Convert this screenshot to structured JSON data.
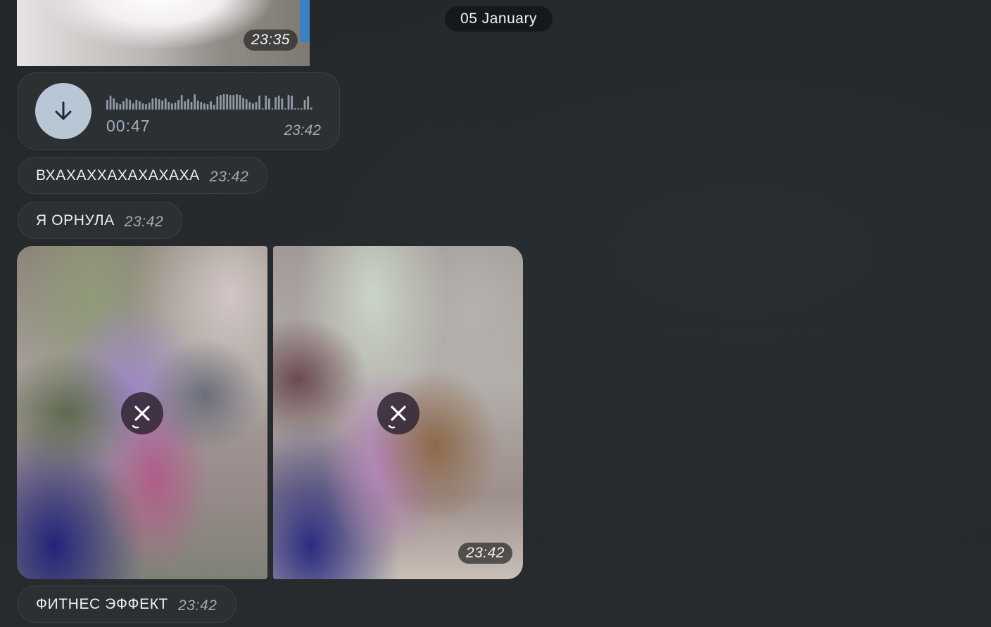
{
  "date_separator": "05 January",
  "messages": [
    {
      "kind": "photo",
      "time": "23:35"
    },
    {
      "kind": "voice",
      "duration": "00:47",
      "time": "23:42"
    },
    {
      "kind": "text",
      "text": "ВХАХАХХАХАХАХАХА",
      "time": "23:42"
    },
    {
      "kind": "text",
      "text": "Я ОРНУЛА",
      "time": "23:42"
    },
    {
      "kind": "album",
      "items": 2,
      "time": "23:42"
    },
    {
      "kind": "text",
      "text": "ФИТНЕС ЭФФЕКТ",
      "time": "23:42"
    }
  ],
  "icons": {
    "download": "arrow-down-icon",
    "cancel": "close-icon"
  },
  "colors": {
    "background": "#262a2d",
    "bubble": "#2c3033",
    "download_button": "#b9c6d6",
    "time_text": "#a3acb5"
  }
}
